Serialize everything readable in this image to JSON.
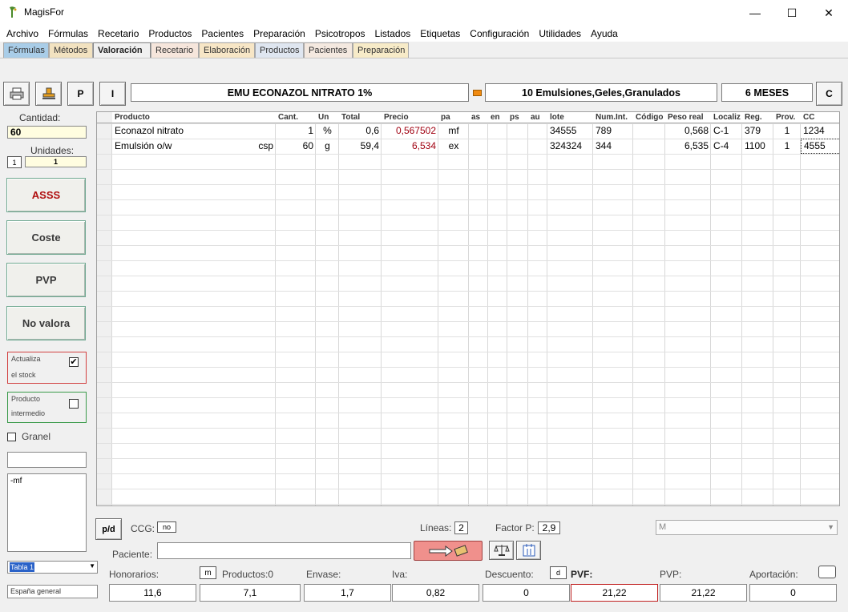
{
  "window": {
    "title": "MagisFor",
    "minimize": "—",
    "maximize": "☐",
    "close": "✕"
  },
  "menu": [
    "Archivo",
    "Fórmulas",
    "Recetario",
    "Productos",
    "Pacientes",
    "Preparación",
    "Psicotropos",
    "Listados",
    "Etiquetas",
    "Configuración",
    "Utilidades",
    "Ayuda"
  ],
  "tabs": [
    "Fórmulas",
    "Métodos",
    "Valoración",
    "Recetario",
    "Elaboración",
    "Productos",
    "Pacientes",
    "Preparación"
  ],
  "header": {
    "btn_p": "P",
    "btn_i": "I",
    "formula_name": "EMU ECONAZOL NITRATO 1%",
    "form_type": "10 Emulsiones,Geles,Granulados",
    "expiry": "6 MESES",
    "btn_c": "C"
  },
  "left": {
    "cantidad_label": "Cantidad:",
    "cantidad_value": "60",
    "unidades_label": "Unidades:",
    "unidades_btn": "1",
    "unidades_value": "1",
    "btn_asss": "ASSS",
    "btn_coste": "Coste",
    "btn_pvp": "PVP",
    "btn_novalora": "No valora",
    "actualiza_line1": "Actualiza",
    "actualiza_line2": "el stock",
    "actualiza_checked": "✔",
    "intermedio_line1": "Producto",
    "intermedio_line2": "intermedio",
    "granel_label": "Granel",
    "notes_value": "-mf",
    "table_select": "Tabla 1",
    "region_value": "España general"
  },
  "grid": {
    "headers": [
      "Producto",
      "Cant.",
      "Un",
      "Total",
      "Precio",
      "pa",
      "as",
      "en",
      "ps",
      "au",
      "lote",
      "Num.Int.",
      "Código",
      "Peso real",
      "Localiz",
      "Reg.",
      "Prov.",
      "CC"
    ],
    "rows": [
      {
        "producto": "Econazol nitrato",
        "extra": "",
        "cant": "1",
        "un": "%",
        "total": "0,6",
        "precio": "0,567502",
        "pa": "mf",
        "lote": "34555",
        "numint": "789",
        "codigo": "",
        "peso": "0,568",
        "localiz": "C-1",
        "reg": "379",
        "prov": "1",
        "cc": "1234"
      },
      {
        "producto": "Emulsión o/w",
        "extra": "csp",
        "cant": "60",
        "un": "g",
        "total": "59,4",
        "precio": "6,534",
        "pa": "ex",
        "lote": "324324",
        "numint": "344",
        "codigo": "",
        "peso": "6,535",
        "localiz": "C-4",
        "reg": "1100",
        "prov": "1",
        "cc": "4555"
      }
    ]
  },
  "footer": {
    "btn_pd": "p/d",
    "ccg_label": "CCG:",
    "ccg_value": "no",
    "lineas_label": "Líneas:",
    "lineas_value": "2",
    "factor_label": "Factor P:",
    "factor_value": "2,9",
    "m_select": "M",
    "paciente_label": "Paciente:",
    "paciente_value": "",
    "honorarios_label": "Honorarios:",
    "m_btn": "m",
    "productos_label": "Productos:0",
    "envase_label": "Envase:",
    "iva_label": "Iva:",
    "descuento_label": "Descuento:",
    "d_btn": "d",
    "pvf_label": "PVF:",
    "pvp_label": "PVP:",
    "aportacion_label": "Aportación:",
    "honorarios": "11,6",
    "productos": "7,1",
    "envase": "1,7",
    "iva": "0,82",
    "descuento": "0",
    "pvf": "21,22",
    "pvp": "21,22",
    "aportacion": "0"
  }
}
